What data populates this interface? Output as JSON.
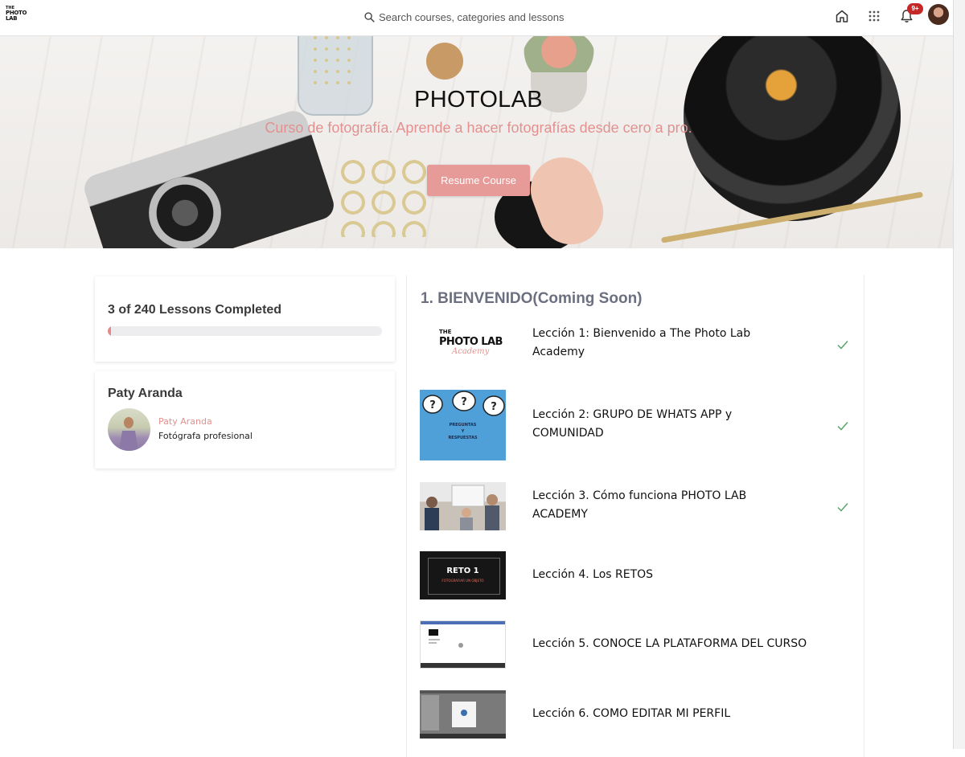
{
  "header": {
    "logo": {
      "line1": "THE",
      "line2": "PHOTO LAB"
    },
    "search_placeholder": "Search courses, categories and lessons",
    "notification_count": "9+",
    "icons": [
      "search-icon",
      "home-icon",
      "apps-grid-icon",
      "bell-icon",
      "user-avatar"
    ]
  },
  "hero": {
    "title": "PHOTOLAB",
    "subtitle": "Curso de fotografía. Aprende a hacer fotografías desde cero a pro.",
    "button_label": "Resume Course"
  },
  "progress": {
    "text": "3 of 240 Lessons Completed",
    "completed": 3,
    "total": 240
  },
  "instructor": {
    "name": "Paty Aranda",
    "link_name": "Paty Aranda",
    "role": "Fotógrafa profesional"
  },
  "section": {
    "title": "1. BIENVENIDO(Coming Soon)",
    "lessons": [
      {
        "title": "Lección 1: Bienvenido a The Photo Lab Academy",
        "completed": true,
        "thumb_text": {
          "line1": "THE",
          "line2": "PHOTO LAB",
          "line3": "Academy"
        }
      },
      {
        "title": "Lección 2: GRUPO DE WHATS APP y COMUNIDAD",
        "completed": true,
        "thumb_text": {
          "line1": "PREGUNTAS",
          "line2": "Y",
          "line3": "RESPUESTAS"
        }
      },
      {
        "title": "Lección 3. Cómo funciona PHOTO LAB ACADEMY",
        "completed": true
      },
      {
        "title": "Lección 4. Los RETOS",
        "completed": false,
        "thumb_text": {
          "line1": "RETO 1",
          "line2": "FOTOGRAFIAR UN OBJETO"
        }
      },
      {
        "title": "Lección 5. CONOCE LA PLATAFORMA DEL CURSO",
        "completed": false
      },
      {
        "title": "Lección 6. COMO EDITAR MI PERFIL",
        "completed": false
      }
    ]
  },
  "colors": {
    "accent": "#e69b98",
    "subtitle": "#e2918f",
    "section_title": "#6c6f80",
    "check": "#5aa469"
  }
}
